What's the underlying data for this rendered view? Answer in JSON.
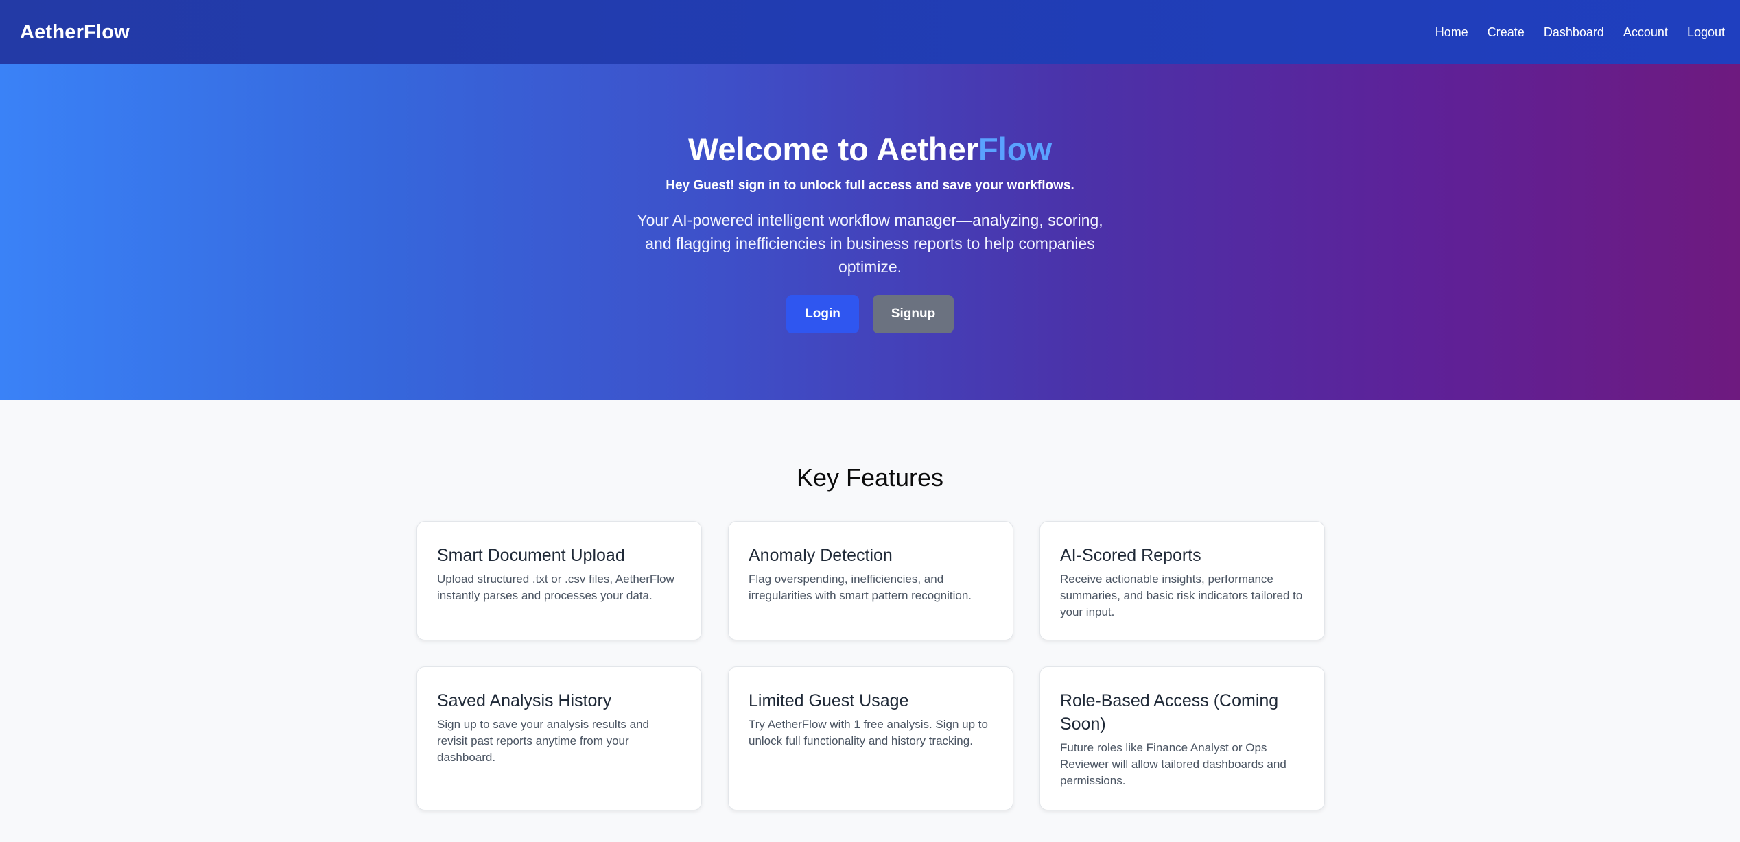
{
  "navbar": {
    "brand": "AetherFlow",
    "links": [
      "Home",
      "Create",
      "Dashboard",
      "Account",
      "Logout"
    ]
  },
  "hero": {
    "title_main": "Welcome to Aether",
    "title_accent": "Flow",
    "guest_message": "Hey Guest! sign in to unlock full access and save your workflows.",
    "description": "Your AI-powered intelligent workflow manager—analyzing, scoring, and flagging inefficiencies in business reports to help companies optimize.",
    "login_label": "Login",
    "signup_label": "Signup"
  },
  "features": {
    "heading": "Key Features",
    "cards": [
      {
        "title": "Smart Document Upload",
        "desc": "Upload structured .txt or .csv files, AetherFlow instantly parses and processes your data."
      },
      {
        "title": "Anomaly Detection",
        "desc": "Flag overspending, inefficiencies, and irregularities with smart pattern recognition."
      },
      {
        "title": "AI-Scored Reports",
        "desc": "Receive actionable insights, performance summaries, and basic risk indicators tailored to your input."
      },
      {
        "title": "Saved Analysis History",
        "desc": "Sign up to save your analysis results and revisit past reports anytime from your dashboard."
      },
      {
        "title": "Limited Guest Usage",
        "desc": "Try AetherFlow with 1 free analysis. Sign up to unlock full functionality and history tracking."
      },
      {
        "title": "Role-Based Access (Coming Soon)",
        "desc": "Future roles like Finance Analyst or Ops Reviewer will allow tailored dashboards and permissions."
      }
    ]
  },
  "colors": {
    "navbar": "#233aa6",
    "accent": "#5aa2ff",
    "login_button": "#2f56f0",
    "signup_button": "#6b7280",
    "background": "#f8f9fb"
  }
}
